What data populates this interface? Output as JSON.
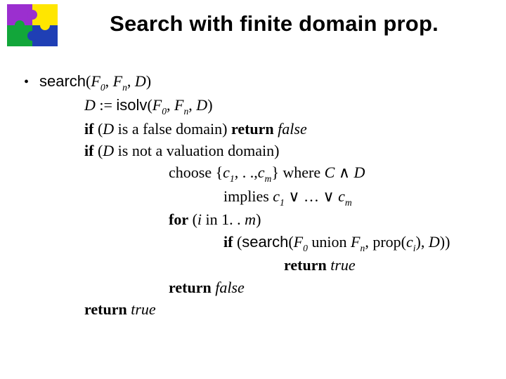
{
  "title": "Search with finite domain prop.",
  "bullet": "•",
  "fn": {
    "search": "search",
    "isolv": "isolv"
  },
  "sym": {
    "F": "F",
    "zero": "0",
    "n": "n",
    "D": "D",
    "c": "c",
    "one": "1",
    "m": "m",
    "i": "i",
    "C": "C",
    "assign": " := ",
    "open": "(",
    "close": ")",
    "comma": ", ",
    "lbrace": "{",
    "rbrace": "}",
    "dots": ", . .,",
    "and": "∧",
    "or": "∨",
    "ell": " … "
  },
  "kw": {
    "if": "if",
    "return": "return",
    "for": "for",
    "choose": "choose",
    "where": "where",
    "implies": "implies",
    "union": "union",
    "prop": "prop",
    "in": "in"
  },
  "txt": {
    "false_domain": " is a false domain) ",
    "not_valuation": " is not a valuation domain)",
    "range": " 1. . ",
    "true": "true",
    "false": "false"
  }
}
